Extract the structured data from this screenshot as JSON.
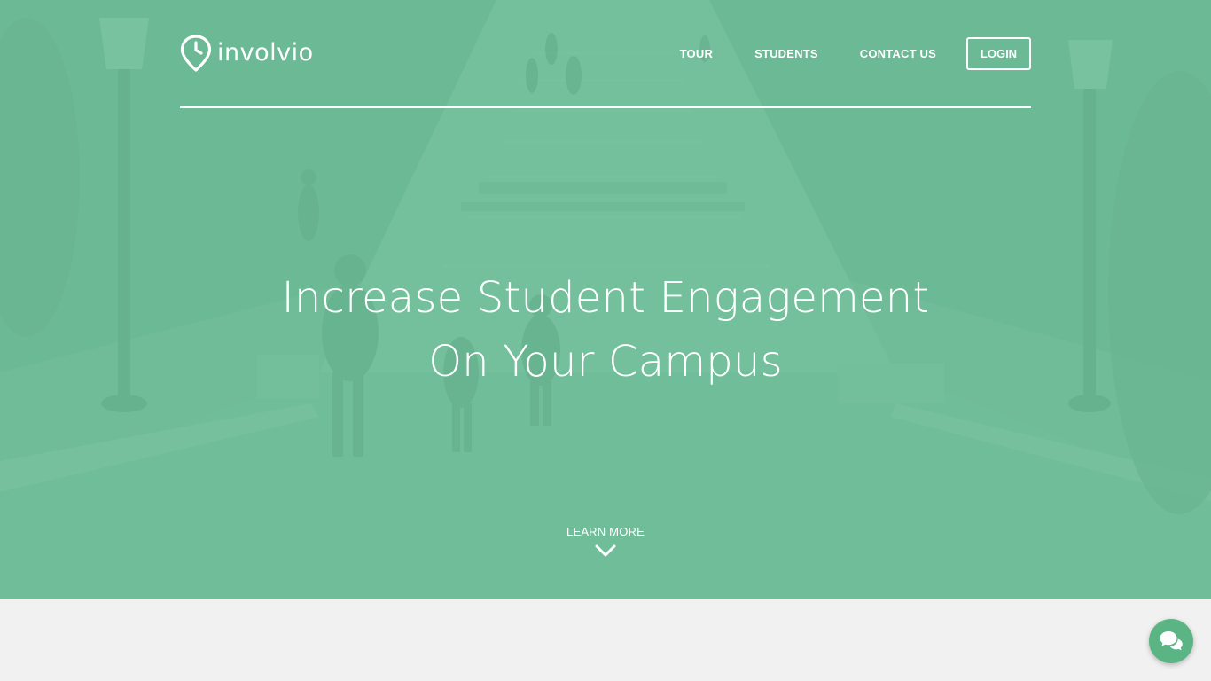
{
  "brand": {
    "name": "involvio",
    "logo_icon": "map-pin-clock-icon"
  },
  "nav": {
    "items": [
      {
        "label": "TOUR"
      },
      {
        "label": "STUDENTS"
      },
      {
        "label": "CONTACT US"
      }
    ],
    "login_label": "LOGIN"
  },
  "hero": {
    "headline_line1": "Increase Student Engagement",
    "headline_line2": "On Your Campus",
    "learn_more_label": "LEARN MORE",
    "learn_more_icon": "chevron-down-icon"
  },
  "chat": {
    "icon": "chat-bubbles-icon"
  },
  "colors": {
    "hero_tint": "#6fba98",
    "page_background": "#f0f1f0",
    "chat_button": "#5ab483",
    "text": "#ffffff"
  }
}
